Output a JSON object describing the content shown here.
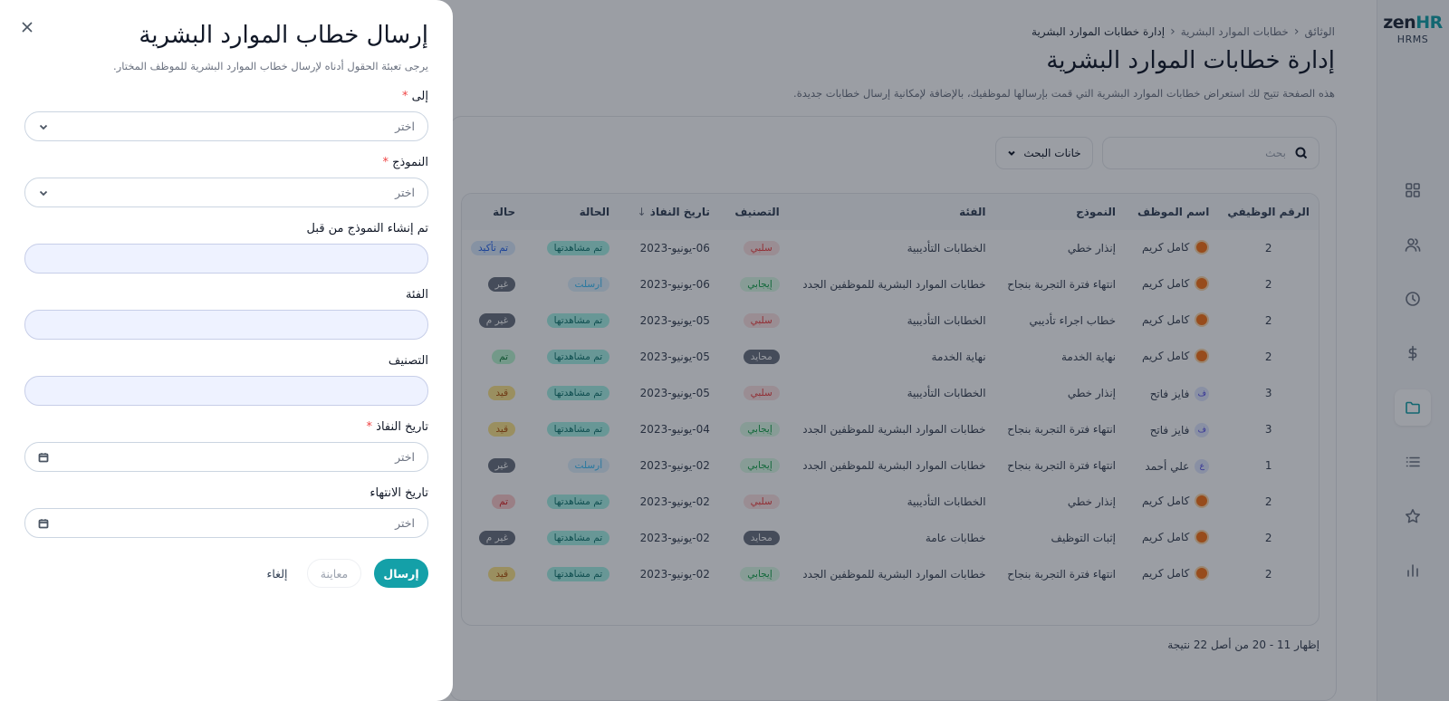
{
  "app": {
    "logo_zen": "zen",
    "logo_hr": "HR",
    "logo_sub": "HRMS"
  },
  "rail": {
    "icons": [
      "dashboard-icon",
      "people-icon",
      "clock-icon",
      "dollar-icon",
      "folder-icon",
      "list-icon",
      "star-icon",
      "chart-icon"
    ],
    "active": "folder-icon"
  },
  "page": {
    "breadcrumb": [
      "الوثائق",
      "خطابات الموارد البشرية",
      "إدارة خطابات الموارد البشرية"
    ],
    "title": "إدارة خطابات الموارد البشرية",
    "description": "هذه الصفحة تتيح لك استعراض خطابات الموارد البشرية التي قمت بإرسالها لموظفيك، بالإضافة لإمكانية إرسال خطابات جديدة.",
    "search_placeholder": "بحث",
    "filter_label": "خانات البحث",
    "results": "إظهار 11 - 20 من أصل 22 نتيجة"
  },
  "table": {
    "columns": [
      "الرقم الوظيفي",
      "اسم الموظف",
      "النموذج",
      "الفئة",
      "التصنيف",
      "تاريخ النفاذ",
      "الحالة",
      "حالة"
    ],
    "rows": [
      {
        "id": "2",
        "avatar": "img",
        "name": "كامل كريم",
        "template": "إنذار خطي",
        "category": "الخطابات التأديبية",
        "class": "سلبي",
        "class_type": "neg",
        "date": "06-يونيو-2023",
        "status": "تم مشاهدتها",
        "status_type": "seen",
        "state": "تم تأكيد",
        "state_type": "blue"
      },
      {
        "id": "2",
        "avatar": "img",
        "name": "كامل كريم",
        "template": "انتهاء فترة التجربة بنجاح",
        "category": "خطابات الموارد البشرية للموظفين الجدد",
        "class": "إيجابي",
        "class_type": "pos",
        "date": "06-يونيو-2023",
        "status": "أرسلت",
        "status_type": "sent",
        "state": "غير",
        "state_type": "gray"
      },
      {
        "id": "2",
        "avatar": "img",
        "name": "كامل كريم",
        "template": "خطاب اجراء تأديبي",
        "category": "الخطابات التأديبية",
        "class": "سلبي",
        "class_type": "neg",
        "date": "05-يونيو-2023",
        "status": "تم مشاهدتها",
        "status_type": "seen",
        "state": "غير م",
        "state_type": "gray"
      },
      {
        "id": "2",
        "avatar": "img",
        "name": "كامل كريم",
        "template": "نهاية الخدمة",
        "category": "نهاية الخدمة",
        "class": "محايد",
        "class_type": "neu",
        "date": "05-يونيو-2023",
        "status": "تم مشاهدتها",
        "status_type": "seen",
        "state": "تم",
        "state_type": "green"
      },
      {
        "id": "3",
        "avatar": "ف",
        "name": "فايز فاتح",
        "template": "إنذار خطي",
        "category": "الخطابات التأديبية",
        "class": "سلبي",
        "class_type": "neg",
        "date": "05-يونيو-2023",
        "status": "تم مشاهدتها",
        "status_type": "seen",
        "state": "قيد",
        "state_type": "amber"
      },
      {
        "id": "3",
        "avatar": "ف",
        "name": "فايز فاتح",
        "template": "انتهاء فترة التجربة بنجاح",
        "category": "خطابات الموارد البشرية للموظفين الجدد",
        "class": "إيجابي",
        "class_type": "pos",
        "date": "04-يونيو-2023",
        "status": "تم مشاهدتها",
        "status_type": "seen",
        "state": "قيد",
        "state_type": "amber"
      },
      {
        "id": "1",
        "avatar": "ع",
        "name": "علي أحمد",
        "template": "انتهاء فترة التجربة بنجاح",
        "category": "خطابات الموارد البشرية للموظفين الجدد",
        "class": "إيجابي",
        "class_type": "pos",
        "date": "02-يونيو-2023",
        "status": "أرسلت",
        "status_type": "sent",
        "state": "غير",
        "state_type": "gray"
      },
      {
        "id": "2",
        "avatar": "img",
        "name": "كامل كريم",
        "template": "إنذار خطي",
        "category": "الخطابات التأديبية",
        "class": "سلبي",
        "class_type": "neg",
        "date": "02-يونيو-2023",
        "status": "تم مشاهدتها",
        "status_type": "seen",
        "state": "تم",
        "state_type": "red"
      },
      {
        "id": "2",
        "avatar": "img",
        "name": "كامل كريم",
        "template": "إثبات التوظيف",
        "category": "خطابات عامة",
        "class": "محايد",
        "class_type": "neu",
        "date": "02-يونيو-2023",
        "status": "تم مشاهدتها",
        "status_type": "seen",
        "state": "غير م",
        "state_type": "gray"
      },
      {
        "id": "2",
        "avatar": "img",
        "name": "كامل كريم",
        "template": "انتهاء فترة التجربة بنجاح",
        "category": "خطابات الموارد البشرية للموظفين الجدد",
        "class": "إيجابي",
        "class_type": "pos",
        "date": "02-يونيو-2023",
        "status": "تم مشاهدتها",
        "status_type": "seen",
        "state": "قيد",
        "state_type": "amber"
      }
    ]
  },
  "drawer": {
    "title": "إرسال خطاب الموارد البشرية",
    "subtitle": "يرجى تعبئة الحقول أدناه لإرسال خطاب الموارد البشرية للموظف المختار.",
    "fields": {
      "to": {
        "label": "إلى",
        "placeholder": "اختر"
      },
      "template": {
        "label": "النموذج",
        "placeholder": "اختر"
      },
      "created_by": {
        "label": "تم إنشاء النموذج من قبل",
        "value": ""
      },
      "category": {
        "label": "الفئة",
        "value": ""
      },
      "classification": {
        "label": "التصنيف",
        "value": ""
      },
      "effective_date": {
        "label": "تاريخ النفاذ",
        "placeholder": "اختر"
      },
      "end_date": {
        "label": "تاريخ الانتهاء",
        "placeholder": "اختر"
      }
    },
    "required_mark": "*",
    "buttons": {
      "send": "إرسال",
      "preview": "معاينة",
      "cancel": "إلغاء"
    }
  }
}
